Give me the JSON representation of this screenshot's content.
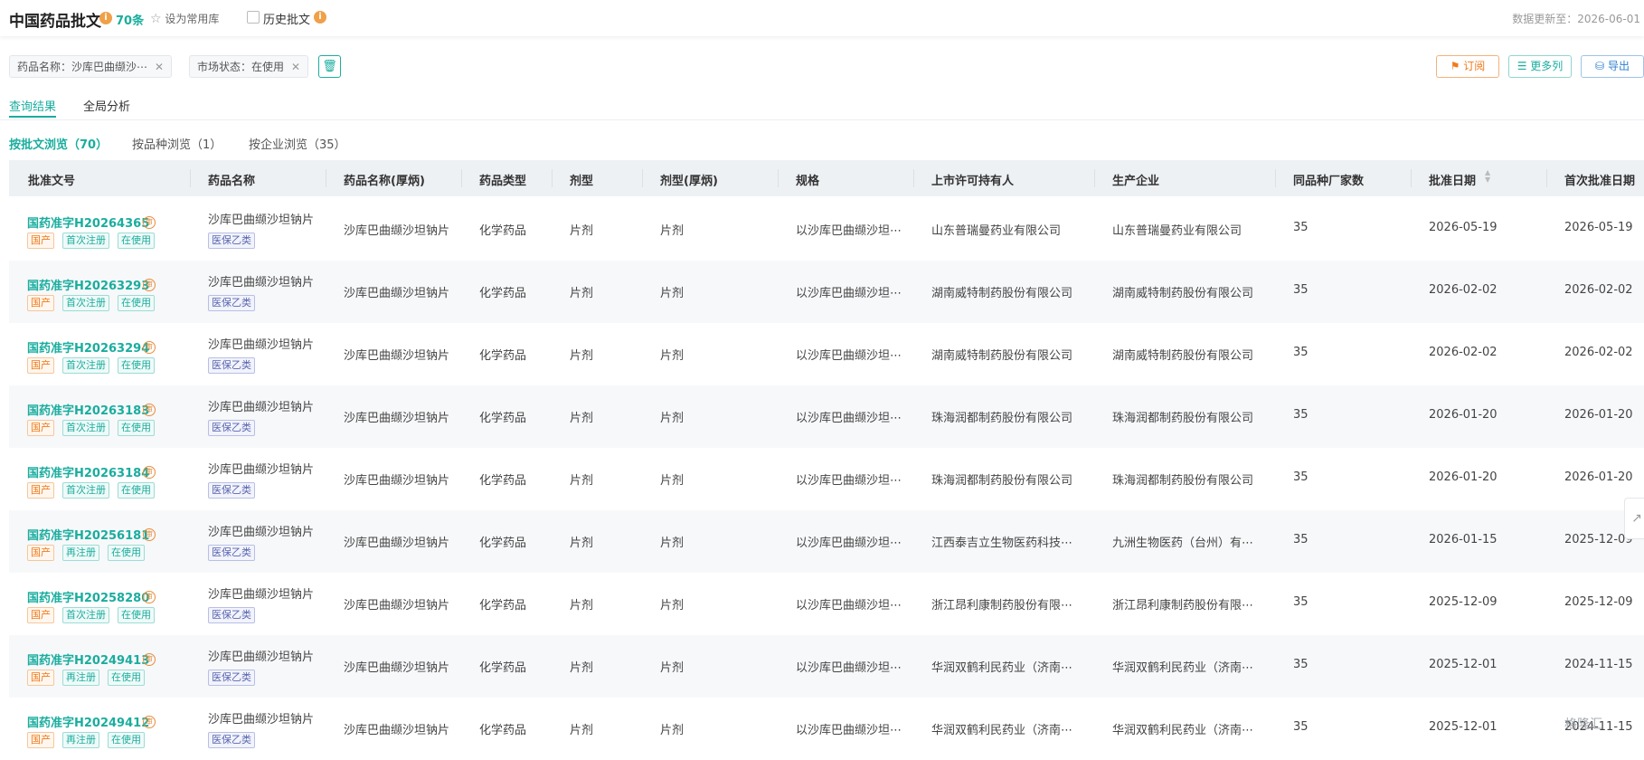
{
  "header": {
    "title": "中国药品批文",
    "count": "70条",
    "favorite_label": "设为常用库",
    "history_label": "历史批文",
    "update_info": "数据更新至：2026-06-01"
  },
  "filters": [
    {
      "label": "药品名称：沙库巴曲缬沙⋯"
    },
    {
      "label": "市场状态：在使用"
    }
  ],
  "actions": {
    "subscribe": "订阅",
    "more_columns": "更多列",
    "export": "导出"
  },
  "tabs": [
    "查询结果",
    "全局分析"
  ],
  "sub_tabs": [
    "按批文浏览（70）",
    "按品种浏览（1）",
    "按企业浏览（35）"
  ],
  "columns": [
    "批准文号",
    "药品名称",
    "药品名称(厚炳)",
    "药品类型",
    "剂型",
    "剂型(厚炳)",
    "规格",
    "上市许可持有人",
    "生产企业",
    "同品种厂家数",
    "批准日期",
    "首次批准日期"
  ],
  "rows": [
    {
      "approval": "国药准字H20264365",
      "tags": [
        "国产",
        "首次注册",
        "在使用"
      ],
      "name": "沙库巴曲缬沙坦钠片",
      "insurance": "医保乙类",
      "name2": "沙库巴曲缬沙坦钠片",
      "type": "化学药品",
      "form": "片剂",
      "form2": "片剂",
      "spec": "以沙库巴曲缬沙坦⋯",
      "holder": "山东普瑞曼药业有限公司",
      "maker": "山东普瑞曼药业有限公司",
      "vendors": "35",
      "date": "2026-05-19",
      "first_date": "2026-05-19"
    },
    {
      "approval": "国药准字H20263293",
      "tags": [
        "国产",
        "首次注册",
        "在使用"
      ],
      "name": "沙库巴曲缬沙坦钠片",
      "insurance": "医保乙类",
      "name2": "沙库巴曲缬沙坦钠片",
      "type": "化学药品",
      "form": "片剂",
      "form2": "片剂",
      "spec": "以沙库巴曲缬沙坦⋯",
      "holder": "湖南威特制药股份有限公司",
      "maker": "湖南威特制药股份有限公司",
      "vendors": "35",
      "date": "2026-02-02",
      "first_date": "2026-02-02"
    },
    {
      "approval": "国药准字H20263294",
      "tags": [
        "国产",
        "首次注册",
        "在使用"
      ],
      "name": "沙库巴曲缬沙坦钠片",
      "insurance": "医保乙类",
      "name2": "沙库巴曲缬沙坦钠片",
      "type": "化学药品",
      "form": "片剂",
      "form2": "片剂",
      "spec": "以沙库巴曲缬沙坦⋯",
      "holder": "湖南威特制药股份有限公司",
      "maker": "湖南威特制药股份有限公司",
      "vendors": "35",
      "date": "2026-02-02",
      "first_date": "2026-02-02"
    },
    {
      "approval": "国药准字H20263183",
      "tags": [
        "国产",
        "首次注册",
        "在使用"
      ],
      "name": "沙库巴曲缬沙坦钠片",
      "insurance": "医保乙类",
      "name2": "沙库巴曲缬沙坦钠片",
      "type": "化学药品",
      "form": "片剂",
      "form2": "片剂",
      "spec": "以沙库巴曲缬沙坦⋯",
      "holder": "珠海润都制药股份有限公司",
      "maker": "珠海润都制药股份有限公司",
      "vendors": "35",
      "date": "2026-01-20",
      "first_date": "2026-01-20"
    },
    {
      "approval": "国药准字H20263184",
      "tags": [
        "国产",
        "首次注册",
        "在使用"
      ],
      "name": "沙库巴曲缬沙坦钠片",
      "insurance": "医保乙类",
      "name2": "沙库巴曲缬沙坦钠片",
      "type": "化学药品",
      "form": "片剂",
      "form2": "片剂",
      "spec": "以沙库巴曲缬沙坦⋯",
      "holder": "珠海润都制药股份有限公司",
      "maker": "珠海润都制药股份有限公司",
      "vendors": "35",
      "date": "2026-01-20",
      "first_date": "2026-01-20"
    },
    {
      "approval": "国药准字H20256181",
      "tags": [
        "国产",
        "再注册",
        "在使用"
      ],
      "name": "沙库巴曲缬沙坦钠片",
      "insurance": "医保乙类",
      "name2": "沙库巴曲缬沙坦钠片",
      "type": "化学药品",
      "form": "片剂",
      "form2": "片剂",
      "spec": "以沙库巴曲缬沙坦⋯",
      "holder": "江西泰吉立生物医药科技⋯",
      "maker": "九洲生物医药（台州）有⋯",
      "vendors": "35",
      "date": "2026-01-15",
      "first_date": "2025-12-09"
    },
    {
      "approval": "国药准字H20258280",
      "tags": [
        "国产",
        "首次注册",
        "在使用"
      ],
      "name": "沙库巴曲缬沙坦钠片",
      "insurance": "医保乙类",
      "name2": "沙库巴曲缬沙坦钠片",
      "type": "化学药品",
      "form": "片剂",
      "form2": "片剂",
      "spec": "以沙库巴曲缬沙坦⋯",
      "holder": "浙江昂利康制药股份有限⋯",
      "maker": "浙江昂利康制药股份有限⋯",
      "vendors": "35",
      "date": "2025-12-09",
      "first_date": "2025-12-09"
    },
    {
      "approval": "国药准字H20249413",
      "tags": [
        "国产",
        "再注册",
        "在使用"
      ],
      "name": "沙库巴曲缬沙坦钠片",
      "insurance": "医保乙类",
      "name2": "沙库巴曲缬沙坦钠片",
      "type": "化学药品",
      "form": "片剂",
      "form2": "片剂",
      "spec": "以沙库巴曲缬沙坦⋯",
      "holder": "华润双鹤利民药业（济南⋯",
      "maker": "华润双鹤利民药业（济南⋯",
      "vendors": "35",
      "date": "2025-12-01",
      "first_date": "2024-11-15"
    },
    {
      "approval": "国药准字H20249412",
      "tags": [
        "国产",
        "再注册",
        "在使用"
      ],
      "name": "沙库巴曲缬沙坦钠片",
      "insurance": "医保乙类",
      "name2": "沙库巴曲缬沙坦钠片",
      "type": "化学药品",
      "form": "片剂",
      "form2": "片剂",
      "spec": "以沙库巴曲缬沙坦⋯",
      "holder": "华润双鹤利民药业（济南⋯",
      "maker": "华润双鹤利民药业（济南⋯",
      "vendors": "35",
      "date": "2025-12-01",
      "first_date": "2024-11-15"
    }
  ],
  "watermark": "格隆汇",
  "colors": {
    "accent": "#1aad9e",
    "orange": "#f07a1a",
    "purple": "#5866b0"
  }
}
